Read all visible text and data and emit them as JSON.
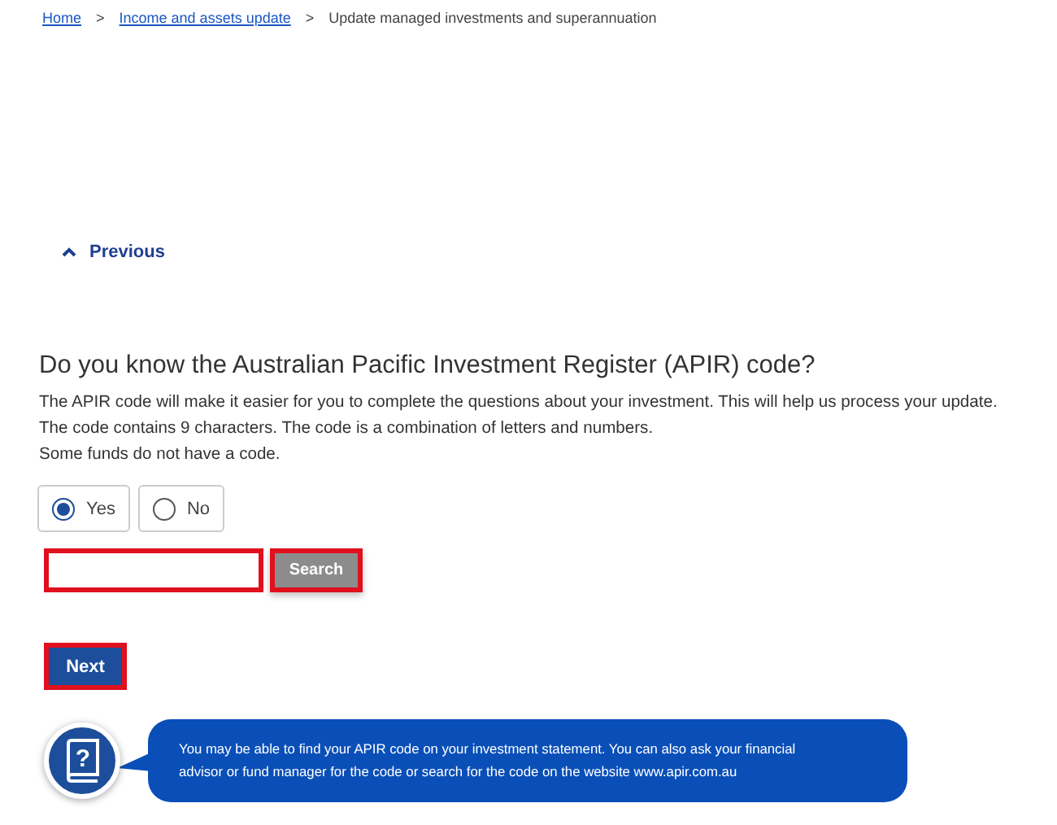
{
  "breadcrumb": [
    {
      "label": "Home",
      "link": true
    },
    {
      "label": "Income and assets update",
      "link": true
    },
    {
      "label": "Update managed investments and superannuation",
      "link": false
    }
  ],
  "breadcrumb_separator": ">",
  "previous_link": "Previous",
  "question": "Do you know the Australian Pacific Investment Register (APIR) code?",
  "description": [
    "The APIR code will make it easier for you to complete the questions about your investment. This will help us process your update.",
    "The code contains 9 characters. The code is a combination of letters and numbers.",
    "Some funds do not have a code."
  ],
  "options": [
    {
      "label": "Yes",
      "selected": true
    },
    {
      "label": "No",
      "selected": false
    }
  ],
  "search_button": "Search",
  "next_button": "Next",
  "help": {
    "icon_glyph": "?",
    "text": "You may be able to find your APIR code on your investment statement. You can also ask your financial advisor or fund manager for the code or search for the code on the website www.apir.com.au"
  }
}
